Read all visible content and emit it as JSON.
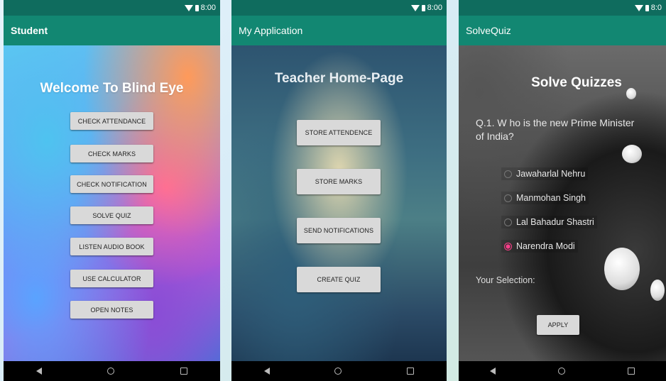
{
  "status_time": "8:00",
  "status_time_clipped": "8:0",
  "screens": {
    "student": {
      "title": "Student",
      "headline": "Welcome To Blind Eye",
      "buttons": [
        "CHECK ATTENDANCE",
        "CHECK MARKS",
        "CHECK NOTIFICATION",
        "SOLVE QUIZ",
        "LISTEN AUDIO BOOK",
        "USE CALCULATOR",
        "OPEN NOTES"
      ]
    },
    "teacher": {
      "title": "My Application",
      "headline": "Teacher Home-Page",
      "buttons": [
        "STORE ATTENDENCE",
        "STORE MARKS",
        "SEND NOTIFICATIONS",
        "CREATE QUIZ"
      ]
    },
    "quiz": {
      "title": "SolveQuiz",
      "headline": "Solve Quizzes",
      "question": "Q.1. W ho is the new Prime Minister of India?",
      "options": [
        "Jawaharlal Nehru",
        "Manmohan Singh",
        "Lal Bahadur Shastri",
        "Narendra Modi"
      ],
      "selected_index": 3,
      "selection_label": "Your Selection:",
      "apply_label": "APPLY"
    }
  },
  "colors": {
    "appbar": "#128772",
    "statusbar": "#0f6c5e",
    "radio_accent": "#ff3d8a"
  },
  "icons": {
    "status": [
      "wifi-icon",
      "battery-icon"
    ],
    "nav": [
      "back-icon",
      "home-icon",
      "recents-icon"
    ]
  }
}
